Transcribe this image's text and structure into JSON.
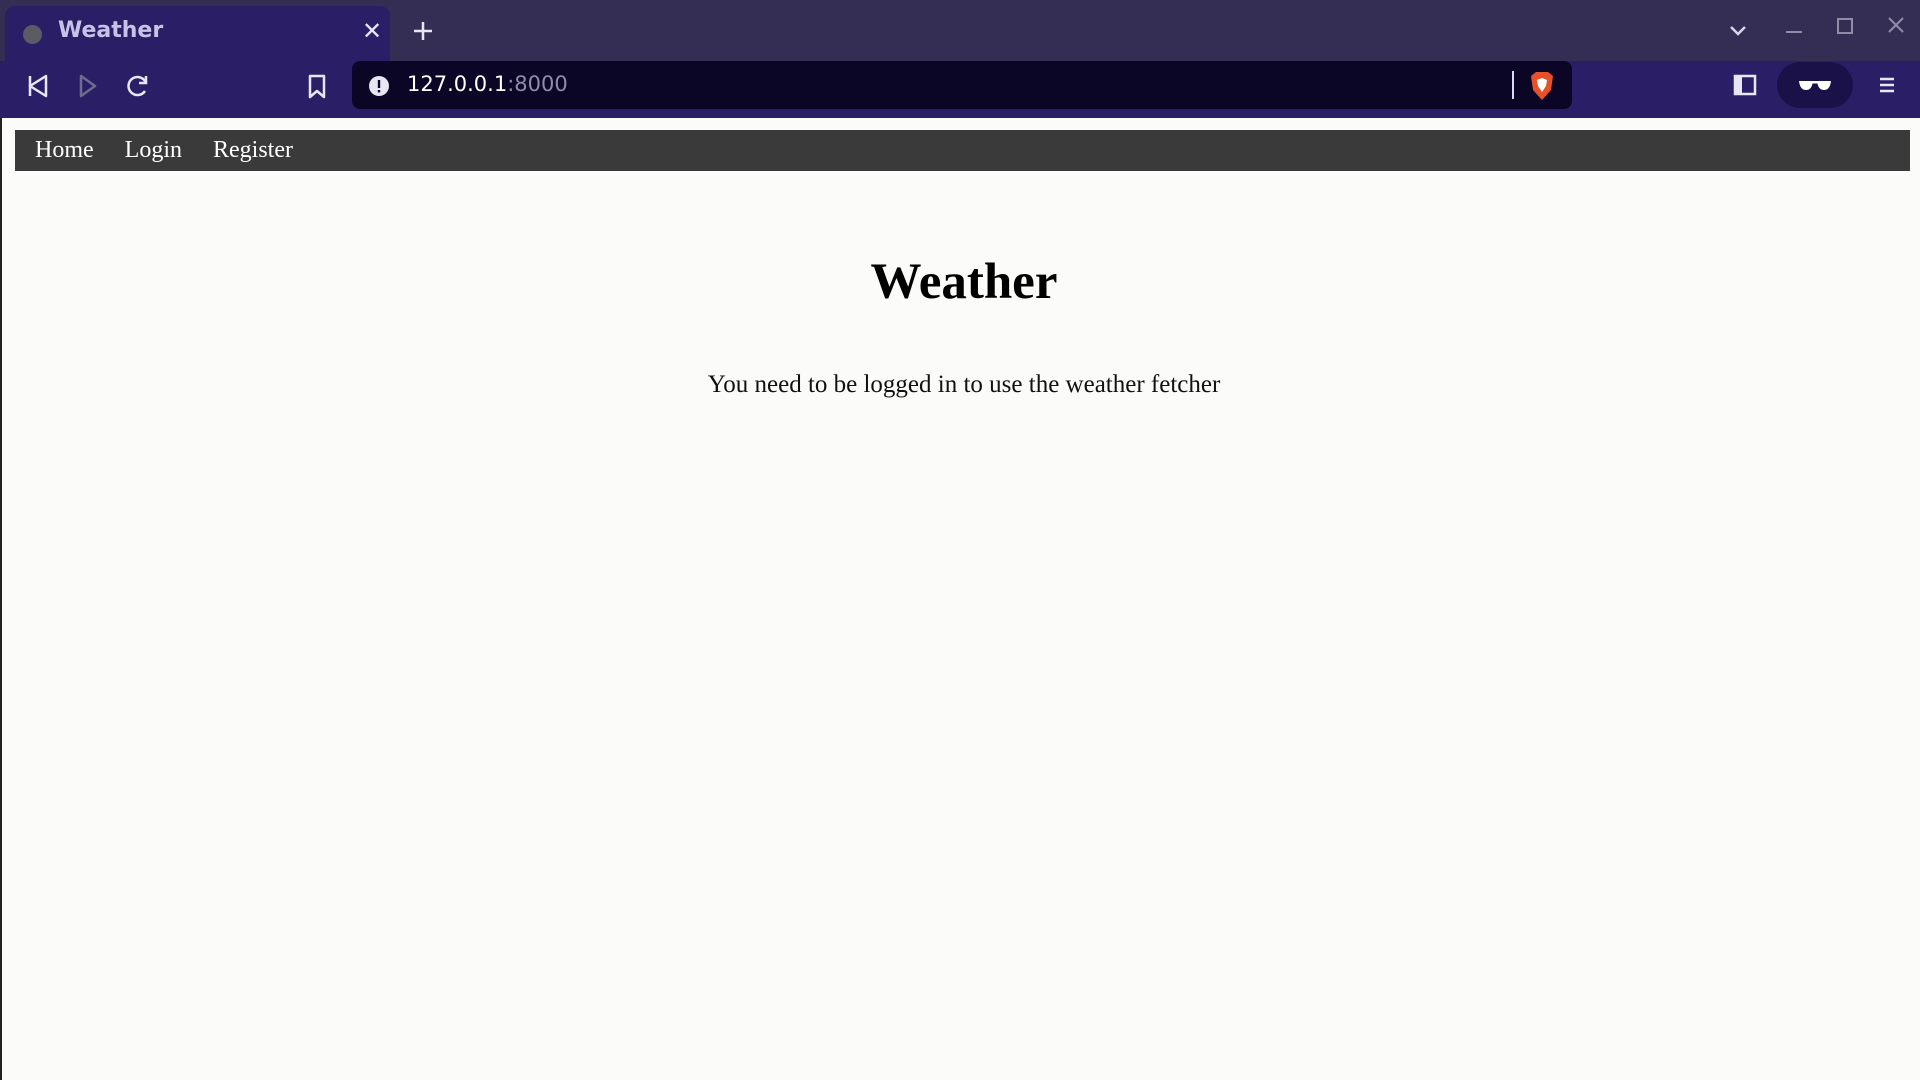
{
  "browser": {
    "tab": {
      "title": "Weather",
      "favicon": "globe-icon",
      "close": "✕"
    },
    "new_tab": "plus-icon",
    "address": {
      "host": "127.0.0.1",
      "port": ":8000"
    },
    "toolbar_icons": [
      "back-icon",
      "forward-icon",
      "reload-icon",
      "bookmark-icon",
      "site-info-icon",
      "brave-shield-icon",
      "sidebar-icon",
      "private-glasses-icon",
      "menu-icon"
    ],
    "window_controls": [
      "chevron-down-icon",
      "minimize-icon",
      "maximize-icon",
      "close-icon"
    ],
    "colors": {
      "chrome": "#2a1f66",
      "tabstrip": "#342e54",
      "urlbar": "#0b0626",
      "shield": "#e8502a"
    }
  },
  "page": {
    "nav": {
      "items": [
        {
          "label": "Home"
        },
        {
          "label": "Login"
        },
        {
          "label": "Register"
        }
      ],
      "background": "#3a3a3a"
    },
    "title": "Weather",
    "message": "You need to be logged in to use the weather fetcher"
  }
}
